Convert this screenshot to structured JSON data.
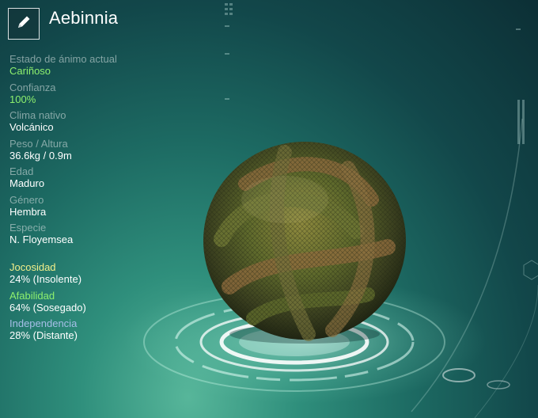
{
  "creature_name": "Aebinnia",
  "icons": {
    "edit": "pencil-icon"
  },
  "stats": [
    {
      "label": "Estado de ánimo actual",
      "value": "Cariñoso",
      "highlight": true
    },
    {
      "label": "Confianza",
      "value": "100%",
      "highlight": true
    },
    {
      "label": "Clima nativo",
      "value": "Volcánico",
      "highlight": false
    },
    {
      "label": "Peso / Altura",
      "value": "36.6kg / 0.9m",
      "highlight": false
    },
    {
      "label": "Edad",
      "value": "Maduro",
      "highlight": false
    },
    {
      "label": "Género",
      "value": "Hembra",
      "highlight": false
    },
    {
      "label": "Especie",
      "value": "N. Floyemsea",
      "highlight": false
    }
  ],
  "traits": [
    {
      "name": "Jocosidad",
      "value": "24% (Insolente)",
      "color": "#f2ef8a"
    },
    {
      "name": "Afabilidad",
      "value": "64% (Sosegado)",
      "color": "#8ef06e"
    },
    {
      "name": "Independencia",
      "value": "28% (Distante)",
      "color": "#a6bfe8"
    }
  ],
  "colors": {
    "accent_green": "#8ef06e",
    "text": "#ffffff"
  }
}
